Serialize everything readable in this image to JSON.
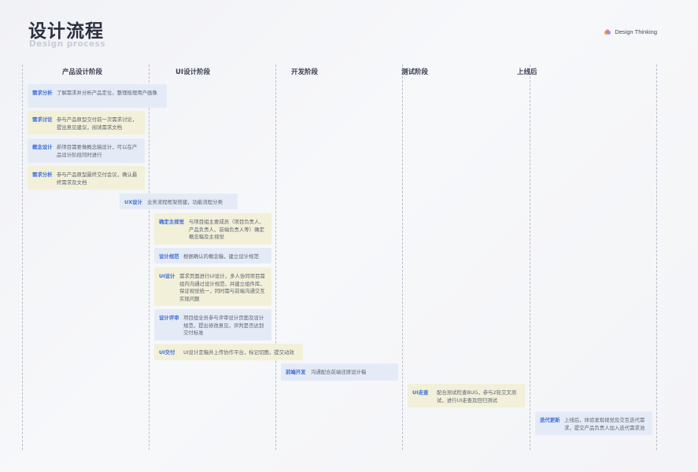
{
  "header": {
    "title": "设计流程",
    "subtitle": "Design process",
    "brand": "Design Thinking"
  },
  "phases": [
    "产品设计阶段",
    "UI设计阶段",
    "开发阶段",
    "测试阶段",
    "上线后"
  ],
  "tasks": [
    {
      "label": "需求分析",
      "desc": "了解需求并分析产品定位，整理梳理用户画像",
      "color": "blue"
    },
    {
      "label": "需求讨论",
      "desc": "参与产品原型交付前一次需求讨论，提出意见建议，阅读需求文档",
      "color": "yellow"
    },
    {
      "label": "概念设计",
      "desc": "新项目需要做概念稿设计，可以在产品设计阶段同时进行",
      "color": "blue"
    },
    {
      "label": "需求分析",
      "desc": "参与产品原型最终交付会议，确认最终需求及文档",
      "color": "yellow"
    },
    {
      "label": "UX设计",
      "desc": "业务流程框架搭建，功能流程分类",
      "color": "blue"
    },
    {
      "label": "确定主视觉",
      "desc": "与项目组主要成员（项目负责人、产品负责人、前端负责人等）确定概念稿及主视觉",
      "color": "yellow"
    },
    {
      "label": "设计规范",
      "desc": "根据确认的概念稿，建立设计规范",
      "color": "blue"
    },
    {
      "label": "UI设计",
      "desc": "需求页面进行UI设计，多人协同项目需组内沟通过设计规范，并建立组件库，保证视觉统一，同时需与前端沟通交互实现问题",
      "color": "yellow"
    },
    {
      "label": "设计评审",
      "desc": "项目组全员参与评审设计页面及设计规范，提出修改意见，评判是否达到交付标准",
      "color": "blue"
    },
    {
      "label": "UI交付",
      "desc": "UI设计定稿并上传协作平台，标记切图，提交动效",
      "color": "yellow"
    },
    {
      "label": "前端开发",
      "desc": "沟通配合前端还原设计稿",
      "color": "blue"
    },
    {
      "label": "UI走查",
      "desc": "配合测试检查BUG，参与2轮交叉测试，进行UI走查及回归测试",
      "color": "yellow"
    },
    {
      "label": "迭代更新",
      "desc": "上线后，体验发现视觉及交互迭代需求，提交产品负责人加入迭代需求池",
      "color": "blue"
    }
  ],
  "colors": {
    "blue_card": "#e5ebf6",
    "yellow_card": "#f2f0d9",
    "accent": "#3f6fd6"
  }
}
